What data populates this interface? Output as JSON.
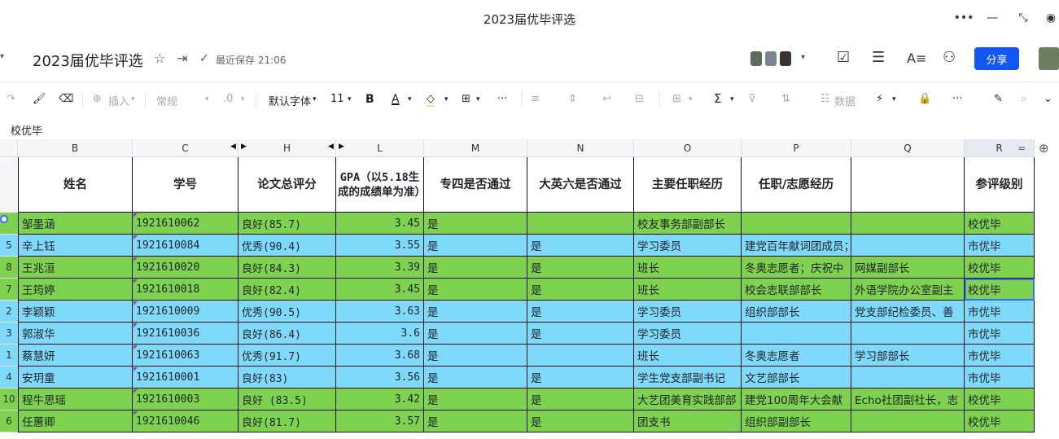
{
  "window": {
    "title": "2023届优毕评选"
  },
  "header": {
    "doc_title": "2023届优毕评选",
    "save_status": "最近保存 21:06",
    "share_label": "分享"
  },
  "toolbar": {
    "insert_label": "插入",
    "format_label": "常规",
    "decimal_label": ".0",
    "font_label": "默认字体",
    "font_size": "11",
    "bold_label": "B",
    "text_color_label": "A",
    "sum_label": "Σ",
    "data_label": "数据",
    "more_label": "···"
  },
  "formula_bar": {
    "content": "校优毕"
  },
  "columns": [
    {
      "id": "B",
      "header": "姓名"
    },
    {
      "id": "C",
      "header": "学号"
    },
    {
      "id": "H",
      "header": "论文总评分"
    },
    {
      "id": "L",
      "header": "GPA（以5.18生成的成绩单为准）"
    },
    {
      "id": "M",
      "header": "专四是否通过"
    },
    {
      "id": "N",
      "header": "大英六是否通过"
    },
    {
      "id": "O",
      "header": "主要任职经历"
    },
    {
      "id": "P",
      "header": "任职/志愿经历"
    },
    {
      "id": "Q",
      "header": ""
    },
    {
      "id": "R",
      "header": "参评级别"
    }
  ],
  "rows": [
    {
      "num": "",
      "color": "green",
      "cells": [
        "邹墨涵",
        "1921610062",
        "良好(85.7)",
        "3.45",
        "是",
        "",
        "校友事务部副部长",
        "",
        "",
        "校优毕"
      ]
    },
    {
      "num": "5",
      "color": "blue",
      "cells": [
        "辛上钰",
        "1921610084",
        "优秀(90.4)",
        "3.55",
        "是",
        "是",
        "学习委员",
        "建党百年献词团成员；党宣校电视台主编",
        "",
        "市优毕"
      ]
    },
    {
      "num": "8",
      "color": "green",
      "cells": [
        "王兆洹",
        "1921610020",
        "良好(84.3)",
        "3.39",
        "是",
        "是",
        "班长",
        "冬奥志愿者；庆祝中",
        "网媒副部长",
        "校优毕"
      ]
    },
    {
      "num": "7",
      "color": "green",
      "cells": [
        "王筠婷",
        "1921610018",
        "良好(82.4)",
        "3.45",
        "是",
        "是",
        "班长",
        "校会志联部部长",
        "外语学院办公室副主",
        "校优毕"
      ]
    },
    {
      "num": "2",
      "color": "blue",
      "cells": [
        "李颖颖",
        "1921610009",
        "优秀(90.5)",
        "3.63",
        "是",
        "是",
        "学习委员",
        "组织部部长",
        "党支部纪检委员、善",
        "市优毕"
      ]
    },
    {
      "num": "3",
      "color": "blue",
      "cells": [
        "郭淑华",
        "1921610036",
        "良好(86.4)",
        "3.6",
        "是",
        "是",
        "学习委员",
        "",
        "",
        "市优毕"
      ]
    },
    {
      "num": "1",
      "color": "blue",
      "cells": [
        "蔡慧妍",
        "1921610063",
        "优秀(91.7)",
        "3.68",
        "是",
        "",
        "班长",
        "冬奥志愿者",
        "学习部部长",
        "市优毕"
      ]
    },
    {
      "num": "4",
      "color": "blue",
      "cells": [
        "安玥童",
        "1921610001",
        "良好(83)",
        "3.56",
        "是",
        "是",
        "学生党支部副书记",
        "文艺部部长",
        "",
        "市优毕"
      ]
    },
    {
      "num": "10",
      "color": "green",
      "cells": [
        "程牛思瑶",
        "1921610003",
        "良好 (83.5)",
        "3.42",
        "是",
        "是",
        "大艺团美育实践部部",
        "建党100周年大会献",
        "Echo社团副社长，志",
        "校优毕"
      ]
    },
    {
      "num": "6",
      "color": "green",
      "cells": [
        "任蕙卿",
        "1921610046",
        "良好(81.7)",
        "3.57",
        "是",
        "是",
        "团支书",
        "组织部副部长",
        "",
        "校优毕"
      ]
    }
  ]
}
